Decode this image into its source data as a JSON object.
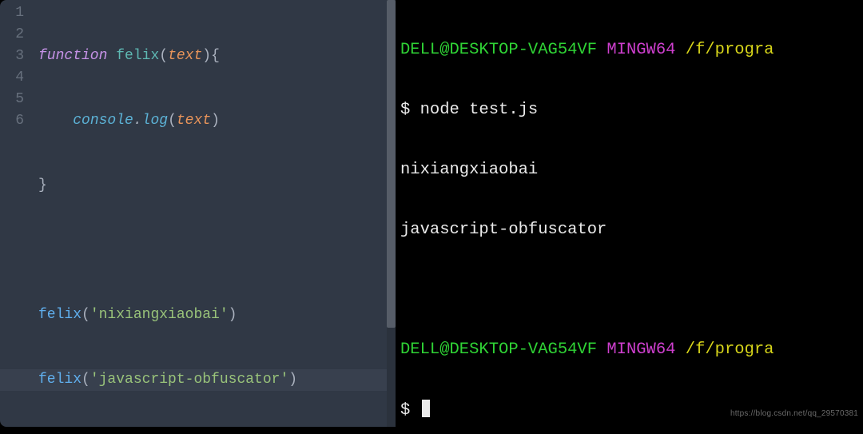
{
  "editor": {
    "line_numbers": [
      "1",
      "2",
      "3",
      "4",
      "5",
      "6"
    ],
    "current_line_index": 5,
    "lines": {
      "l1": {
        "kw": "function",
        "sp": " ",
        "name": "felix",
        "open": "(",
        "param": "text",
        "close": ")",
        "brace": "{"
      },
      "l2": {
        "indent": "    ",
        "obj": "console",
        "dot": ".",
        "method": "log",
        "open": "(",
        "arg": "text",
        "close": ")"
      },
      "l3": {
        "brace": "}"
      },
      "l5": {
        "call": "felix",
        "open": "(",
        "str": "'nixiangxiaobai'",
        "close": ")"
      },
      "l6": {
        "call": "felix",
        "open": "(",
        "str": "'javascript-obfuscator'",
        "close": ")"
      }
    }
  },
  "terminal": {
    "prompt1": {
      "user": "DELL@DESKTOP-VAG54VF",
      "mingw": " MINGW64 ",
      "path": "/f/progra"
    },
    "command1": {
      "dollar": "$ ",
      "cmd": "node test.js"
    },
    "out1": "nixiangxiaobai",
    "out2": "javascript-obfuscator",
    "prompt2": {
      "user": "DELL@DESKTOP-VAG54VF",
      "mingw": " MINGW64 ",
      "path": "/f/progra"
    },
    "command2": {
      "dollar": "$ "
    }
  },
  "watermark": "https://blog.csdn.net/qq_29570381"
}
